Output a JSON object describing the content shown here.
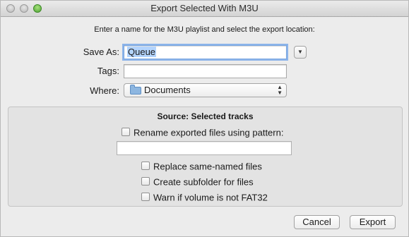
{
  "window": {
    "title": "Export Selected With M3U"
  },
  "instructions": "Enter a name for the M3U playlist and select the export location:",
  "form": {
    "save_as_label": "Save As:",
    "save_as_value": "Queue",
    "tags_label": "Tags:",
    "tags_value": "",
    "where_label": "Where:",
    "where_value": "Documents",
    "where_icon": "folder-icon",
    "disclosure_icon": "chevron-down-icon",
    "popup_icon": "up-down-arrows-icon"
  },
  "source": {
    "title": "Source: Selected tracks",
    "rename_label": "Rename exported files using pattern:",
    "rename_checked": false,
    "pattern_value": "",
    "options": [
      {
        "label": "Replace same-named files",
        "checked": false
      },
      {
        "label": "Create subfolder for files",
        "checked": false
      },
      {
        "label": "Warn if volume is not FAT32",
        "checked": false
      }
    ]
  },
  "buttons": {
    "cancel": "Cancel",
    "export": "Export"
  },
  "colors": {
    "focus_ring": "#8cb4ea",
    "selection": "#b3d4fd",
    "zoom_button": "#4fa234"
  }
}
